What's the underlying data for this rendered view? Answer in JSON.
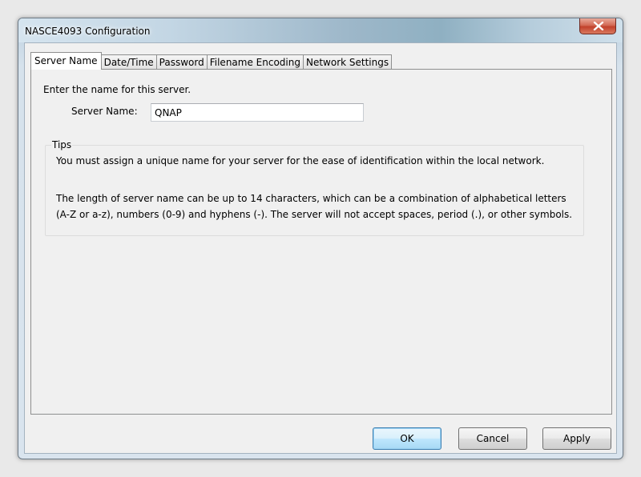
{
  "window": {
    "title": "NASCE4093 Configuration"
  },
  "tabs": [
    {
      "label": "Server Name",
      "active": true
    },
    {
      "label": "Date/Time",
      "active": false
    },
    {
      "label": "Password",
      "active": false
    },
    {
      "label": "Filename Encoding",
      "active": false
    },
    {
      "label": "Network Settings",
      "active": false
    }
  ],
  "server_name_page": {
    "intro": "Enter the name for this server.",
    "field_label": "Server Name:",
    "field_value": "QNAP",
    "tips": {
      "legend": "Tips",
      "line1": "You must assign a unique name for your server for the ease of identification within the local network.",
      "line2": "The length of server name can be up to 14 characters, which can be a combination of alphabetical letters (A-Z or a-z), numbers (0-9) and hyphens (-). The server will not accept spaces, period (.), or other symbols."
    }
  },
  "buttons": {
    "ok": "OK",
    "cancel": "Cancel",
    "apply": "Apply"
  },
  "icons": {
    "close": "close-icon"
  }
}
